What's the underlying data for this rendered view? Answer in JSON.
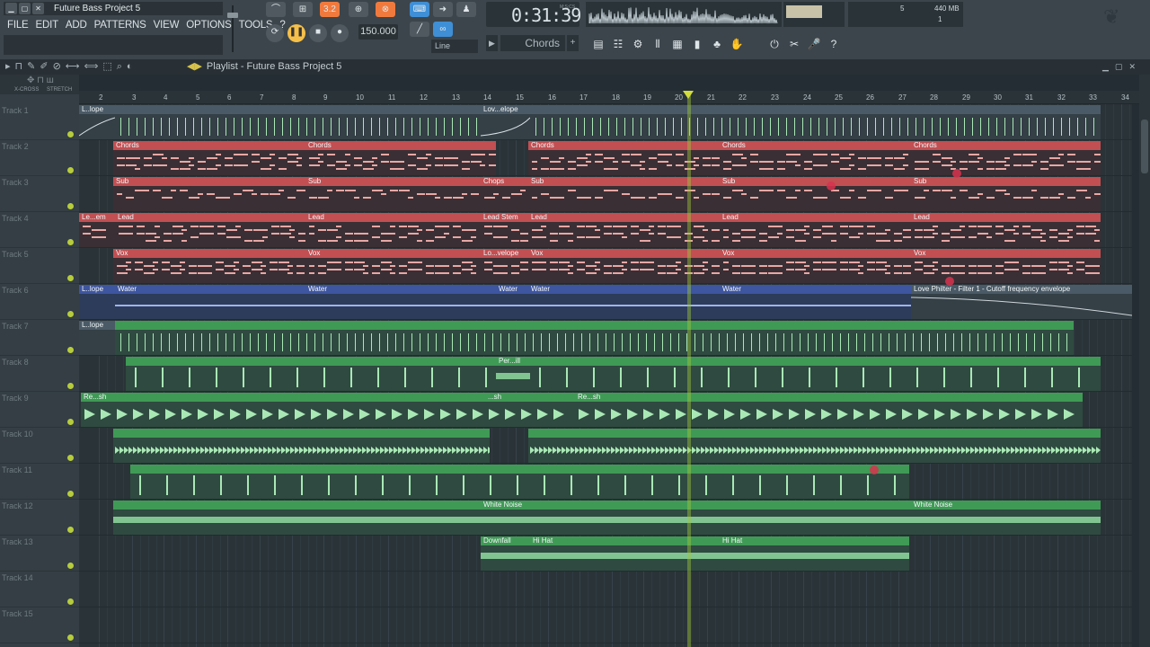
{
  "window": {
    "title": "Future Bass Project 5",
    "buttons": [
      "▁",
      "▢",
      "✕"
    ]
  },
  "menu": [
    "FILE",
    "EDIT",
    "ADD",
    "PATTERNS",
    "VIEW",
    "OPTIONS",
    "TOOLS",
    "?"
  ],
  "transport": {
    "tempo": "150.000",
    "mode_badge": "3.2",
    "snap": "Line"
  },
  "time": {
    "value": "0:31:39",
    "label": "M:S:CS"
  },
  "cpu": {
    "memory": "440 MB",
    "cpu_left": "5",
    "polyphony": "1"
  },
  "pattern": {
    "name": "Chords",
    "plus": "+",
    "arrow": "▶"
  },
  "playlist": {
    "title": "Playlist - Future Bass Project 5",
    "tools_left": [
      "▸",
      "⊓",
      "✎",
      "✐",
      "⊘",
      "⟷",
      "⟺",
      "⬚",
      "⌕",
      "◐"
    ],
    "window_buttons": [
      "▁",
      "▢",
      "✕"
    ],
    "left_tools": {
      "xcross": "X-CROSS",
      "stretch": "STRETCH"
    }
  },
  "ruler": {
    "bars": [
      "2",
      "3",
      "4",
      "5",
      "6",
      "7",
      "8",
      "9",
      "10",
      "11",
      "12",
      "13",
      "14",
      "15",
      "16",
      "17",
      "18",
      "19",
      "20",
      "21",
      "22",
      "23",
      "24",
      "25",
      "26",
      "27",
      "28",
      "29",
      "30",
      "31",
      "32",
      "33",
      "34"
    ]
  },
  "tracks": [
    {
      "name": "Track 1"
    },
    {
      "name": "Track 2"
    },
    {
      "name": "Track 3"
    },
    {
      "name": "Track 4"
    },
    {
      "name": "Track 5"
    },
    {
      "name": "Track 6"
    },
    {
      "name": "Track 7"
    },
    {
      "name": "Track 8"
    },
    {
      "name": "Track 9"
    },
    {
      "name": "Track 10"
    },
    {
      "name": "Track 11"
    },
    {
      "name": "Track 12"
    },
    {
      "name": "Track 13"
    },
    {
      "name": "Track 14"
    },
    {
      "name": "Track 15"
    }
  ],
  "clips": {
    "t1a": "L..lope",
    "t1b": "Lov...elope",
    "t2a": "Chords",
    "t2b": "Chords",
    "t2c": "Chords",
    "t2d": "Chords",
    "t2e": "Chords",
    "t3a": "Sub",
    "t3b": "Sub",
    "t3c": "Chops",
    "t3d": "Sub",
    "t3e": "Sub",
    "t3f": "Sub",
    "t4a": "Le...em",
    "t4b": "Lead",
    "t4c": "Lead",
    "t4d": "Lead Stem",
    "t4e": "Lead",
    "t4f": "Lead",
    "t4g": "Lead",
    "t5a": "Vox",
    "t5b": "Vox",
    "t5c": "Lo...velope",
    "t5d": "Vox",
    "t5e": "Vox",
    "t5f": "Vox",
    "t6a": "L..lope",
    "t6b": "Water",
    "t6c": "Water",
    "t6d": "Water",
    "t6e": "Water",
    "t6f": "Water",
    "t6g": "Love Philter - Filter 1 - Cutoff frequency envelope",
    "t7a": "L..lope",
    "t8a": "Per...ill",
    "t9a": "Re...sh",
    "t9b": "...sh",
    "t9c": "Re...sh",
    "t12a": "White Noise",
    "t12b": "White Noise",
    "t13a": "Downfall",
    "t13b": "Hi Hat",
    "t13c": "Hi Hat"
  },
  "colors": {
    "red": "#c24f52",
    "green": "#3f9a55",
    "blue": "#3e55a0",
    "accent": "#f07a3e"
  }
}
